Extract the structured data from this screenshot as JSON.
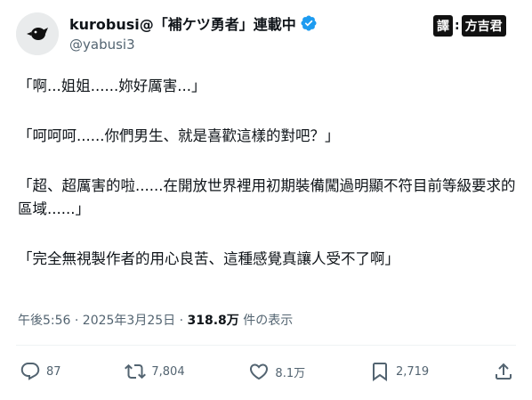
{
  "author": {
    "display_name": "kurobusi@「補ケツ勇者」連載中",
    "handle": "@yabusi3"
  },
  "badge": {
    "left": "譯",
    "sep": ":",
    "right": "方吉君"
  },
  "tweet": {
    "paragraphs": [
      "「啊...姐姐......妳好厲害...」",
      "「呵呵呵......你們男生、就是喜歡這樣的對吧？」",
      "「超、超厲害的啦......在開放世界裡用初期裝備闖過明顯不符目前等級要求的區域......」",
      "「完全無視製作者的用心良苦、這種感覺真讓人受不了啊」"
    ],
    "timestamp": "午後5:56 · 2025年3月25日 · ",
    "views_count": "318.8万",
    "views_suffix": " 件の表示"
  },
  "actions": {
    "reply_count": "87",
    "retweet_count": "7,804",
    "like_count": "8.1万",
    "bookmark_count": "2,719"
  },
  "colors": {
    "verified": "#1d9bf0",
    "muted": "#536471"
  }
}
